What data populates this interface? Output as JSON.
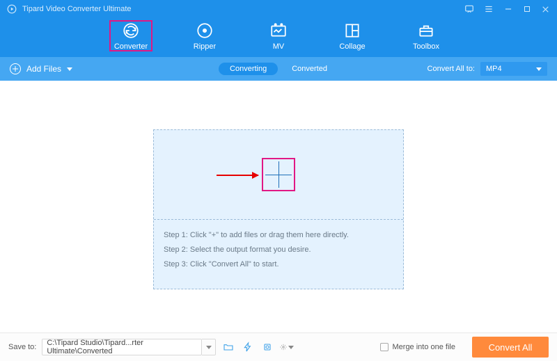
{
  "titlebar": {
    "appName": "Tipard Video Converter Ultimate"
  },
  "nav": {
    "items": [
      {
        "label": "Converter"
      },
      {
        "label": "Ripper"
      },
      {
        "label": "MV"
      },
      {
        "label": "Collage"
      },
      {
        "label": "Toolbox"
      }
    ]
  },
  "subbar": {
    "addFiles": "Add Files",
    "seg": {
      "converting": "Converting",
      "converted": "Converted"
    },
    "convertAllTo": "Convert All to:",
    "format": "MP4"
  },
  "steps": {
    "s1": "Step 1: Click \"+\" to add files or drag them here directly.",
    "s2": "Step 2: Select the output format you desire.",
    "s3": "Step 3: Click \"Convert All\" to start."
  },
  "bottom": {
    "saveTo": "Save to:",
    "path": "C:\\Tipard Studio\\Tipard...rter Ultimate\\Converted",
    "merge": "Merge into one file",
    "convertAll": "Convert All"
  }
}
